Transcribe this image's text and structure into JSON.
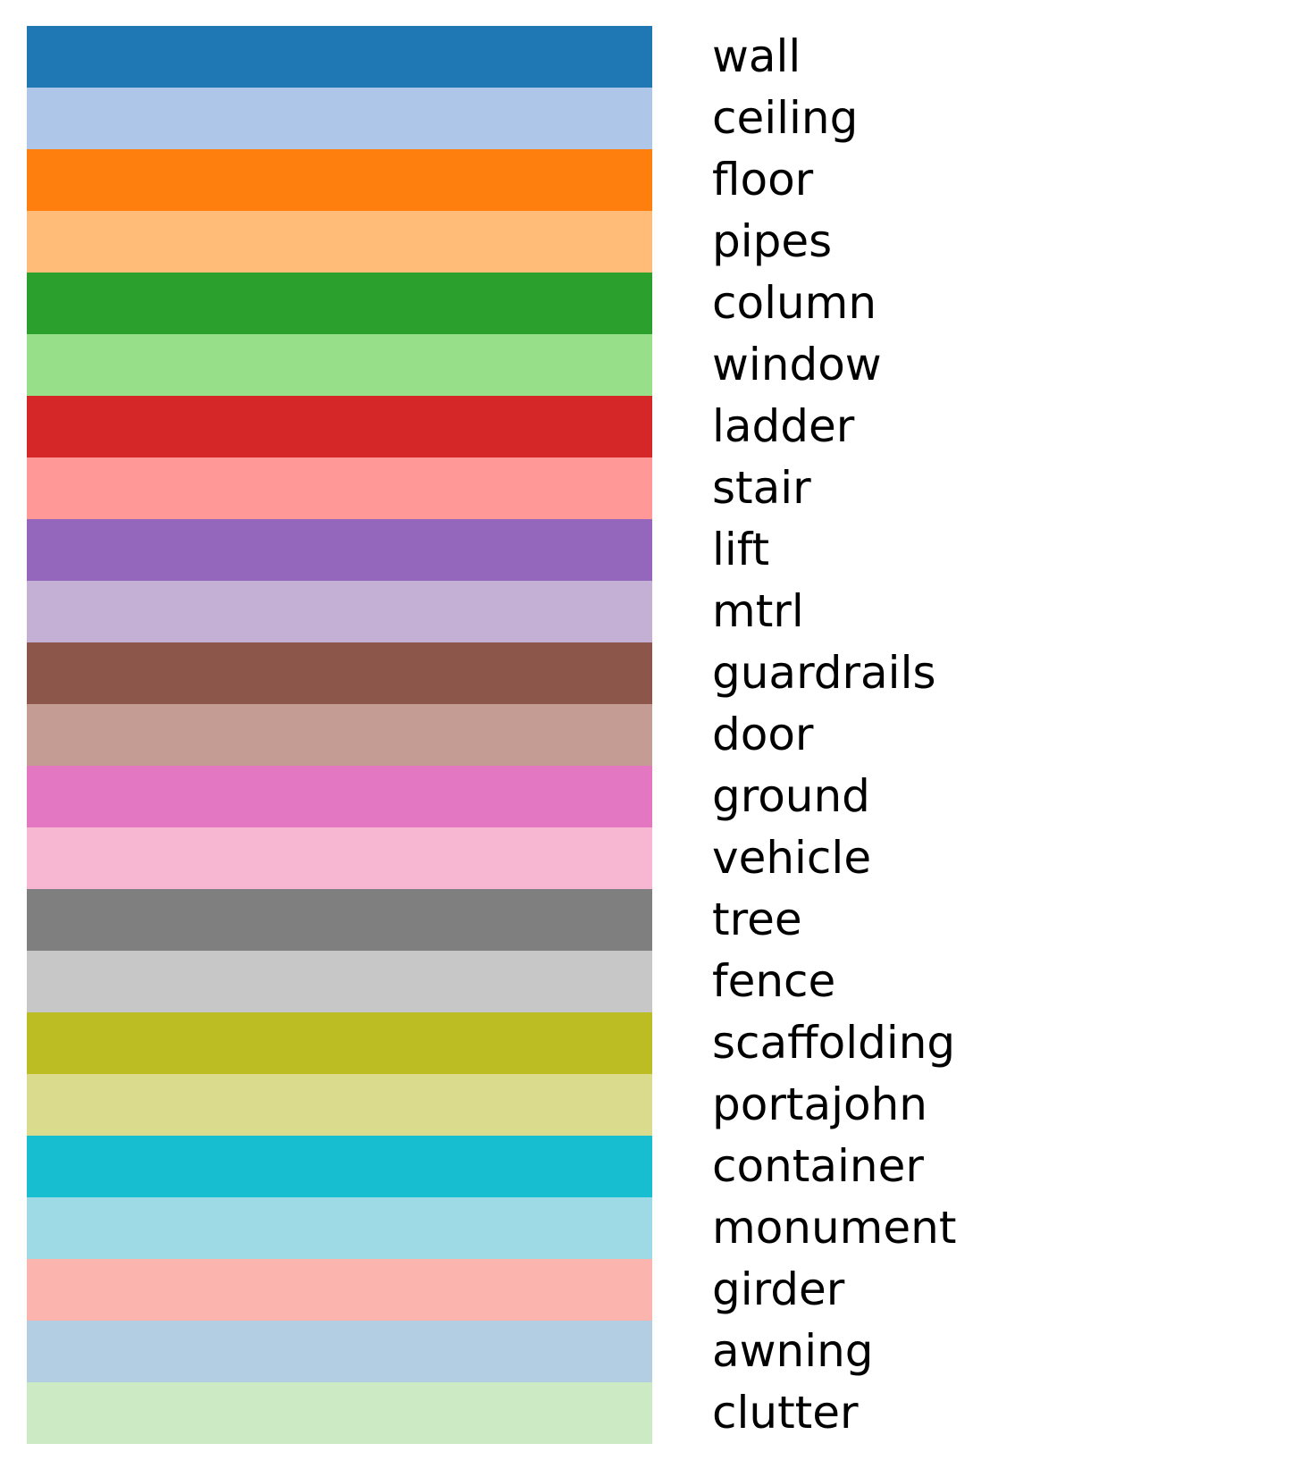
{
  "chart_data": {
    "type": "table",
    "entries": [
      {
        "label": "wall",
        "color": "#1f77b4"
      },
      {
        "label": "ceiling",
        "color": "#aec7e8"
      },
      {
        "label": "floor",
        "color": "#ff7f0e"
      },
      {
        "label": "pipes",
        "color": "#ffbb78"
      },
      {
        "label": "column",
        "color": "#2ca02c"
      },
      {
        "label": "window",
        "color": "#98df8a"
      },
      {
        "label": "ladder",
        "color": "#d62728"
      },
      {
        "label": "stair",
        "color": "#ff9896"
      },
      {
        "label": "lift",
        "color": "#9467bd"
      },
      {
        "label": "mtrl",
        "color": "#c5b0d5"
      },
      {
        "label": "guardrails",
        "color": "#8c564b"
      },
      {
        "label": "door",
        "color": "#c49c94"
      },
      {
        "label": "ground",
        "color": "#e377c2"
      },
      {
        "label": "vehicle",
        "color": "#f7b6d2"
      },
      {
        "label": "tree",
        "color": "#7f7f7f"
      },
      {
        "label": "fence",
        "color": "#c7c7c7"
      },
      {
        "label": "scaffolding",
        "color": "#bcbd22"
      },
      {
        "label": "portajohn",
        "color": "#dbdb8d"
      },
      {
        "label": "container",
        "color": "#17becf"
      },
      {
        "label": "monument",
        "color": "#9edae5"
      },
      {
        "label": "girder",
        "color": "#fbb4ae"
      },
      {
        "label": "awning",
        "color": "#b3cde3"
      },
      {
        "label": "clutter",
        "color": "#ccebc5"
      }
    ]
  }
}
